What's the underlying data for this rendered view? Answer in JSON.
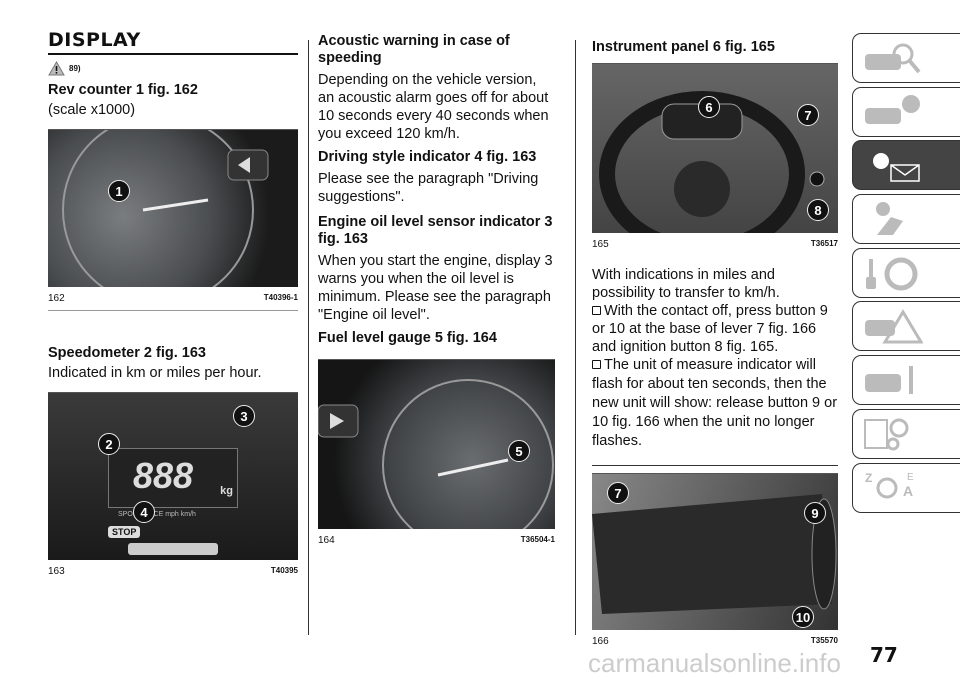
{
  "col1": {
    "title": "DISPLAY",
    "warning_ref": "89)",
    "rev_heading": "Rev counter 1 fig. 162",
    "rev_text": "(scale x1000)",
    "fig162": {
      "num": "162",
      "code": "T40396-1",
      "callouts": [
        "1"
      ]
    },
    "speed_heading": "Speedometer 2 fig. 163",
    "speed_text": "Indicated in km or miles per hour.",
    "fig163": {
      "num": "163",
      "code": "T40395",
      "callouts": [
        "2",
        "3",
        "4"
      ],
      "labels": {
        "digits": "888",
        "stop": "STOP",
        "modes": "SPORT RACE  mph  km/h",
        "kg": "kg"
      }
    }
  },
  "col2": {
    "acoustic_heading": "Acoustic warning in case of speeding",
    "acoustic_text": "Depending on the vehicle version, an acoustic alarm goes off for about 10 seconds every 40 seconds when you exceed 120 km/h.",
    "driving_heading": "Driving style indicator 4 fig. 163",
    "driving_text": "Please see the paragraph \"Driving suggestions\".",
    "oil_heading": "Engine oil level sensor indicator 3 fig. 163",
    "oil_text": "When you start the engine, display 3 warns you when the oil level is minimum. Please see the paragraph \"Engine oil level\".",
    "fuel_heading": "Fuel level gauge 5 fig. 164",
    "fig164": {
      "num": "164",
      "code": "T36504-1",
      "callouts": [
        "5"
      ]
    }
  },
  "col3": {
    "panel_heading": "Instrument panel 6 fig. 165",
    "fig165": {
      "num": "165",
      "code": "T36517",
      "callouts": [
        "6",
        "7",
        "8"
      ]
    },
    "miles_text": "With indications in miles and possibility to transfer to km/h.",
    "step1": "With the contact off, press button 9 or 10 at the base of lever 7 fig. 166 and ignition button 8 fig. 165.",
    "step2": "The unit of measure indicator will flash for about ten seconds, then the new unit will show: release button 9 or 10 fig. 166 when the unit no longer flashes.",
    "fig166": {
      "num": "166",
      "code": "T35570",
      "callouts": [
        "7",
        "9",
        "10"
      ]
    }
  },
  "tabs": [
    {
      "icon": "car-magnifier-icon",
      "active": false
    },
    {
      "icon": "car-info-icon",
      "active": false
    },
    {
      "icon": "warning-light-message-icon",
      "active": true
    },
    {
      "icon": "airbag-seat-icon",
      "active": false
    },
    {
      "icon": "key-steering-wheel-icon",
      "active": false
    },
    {
      "icon": "car-warning-triangle-icon",
      "active": false
    },
    {
      "icon": "car-wrench-icon",
      "active": false
    },
    {
      "icon": "specs-gears-icon",
      "active": false
    },
    {
      "icon": "alphabetical-index-icon",
      "active": false
    }
  ],
  "page_number": "77",
  "watermark": "carmanualsonline.info"
}
